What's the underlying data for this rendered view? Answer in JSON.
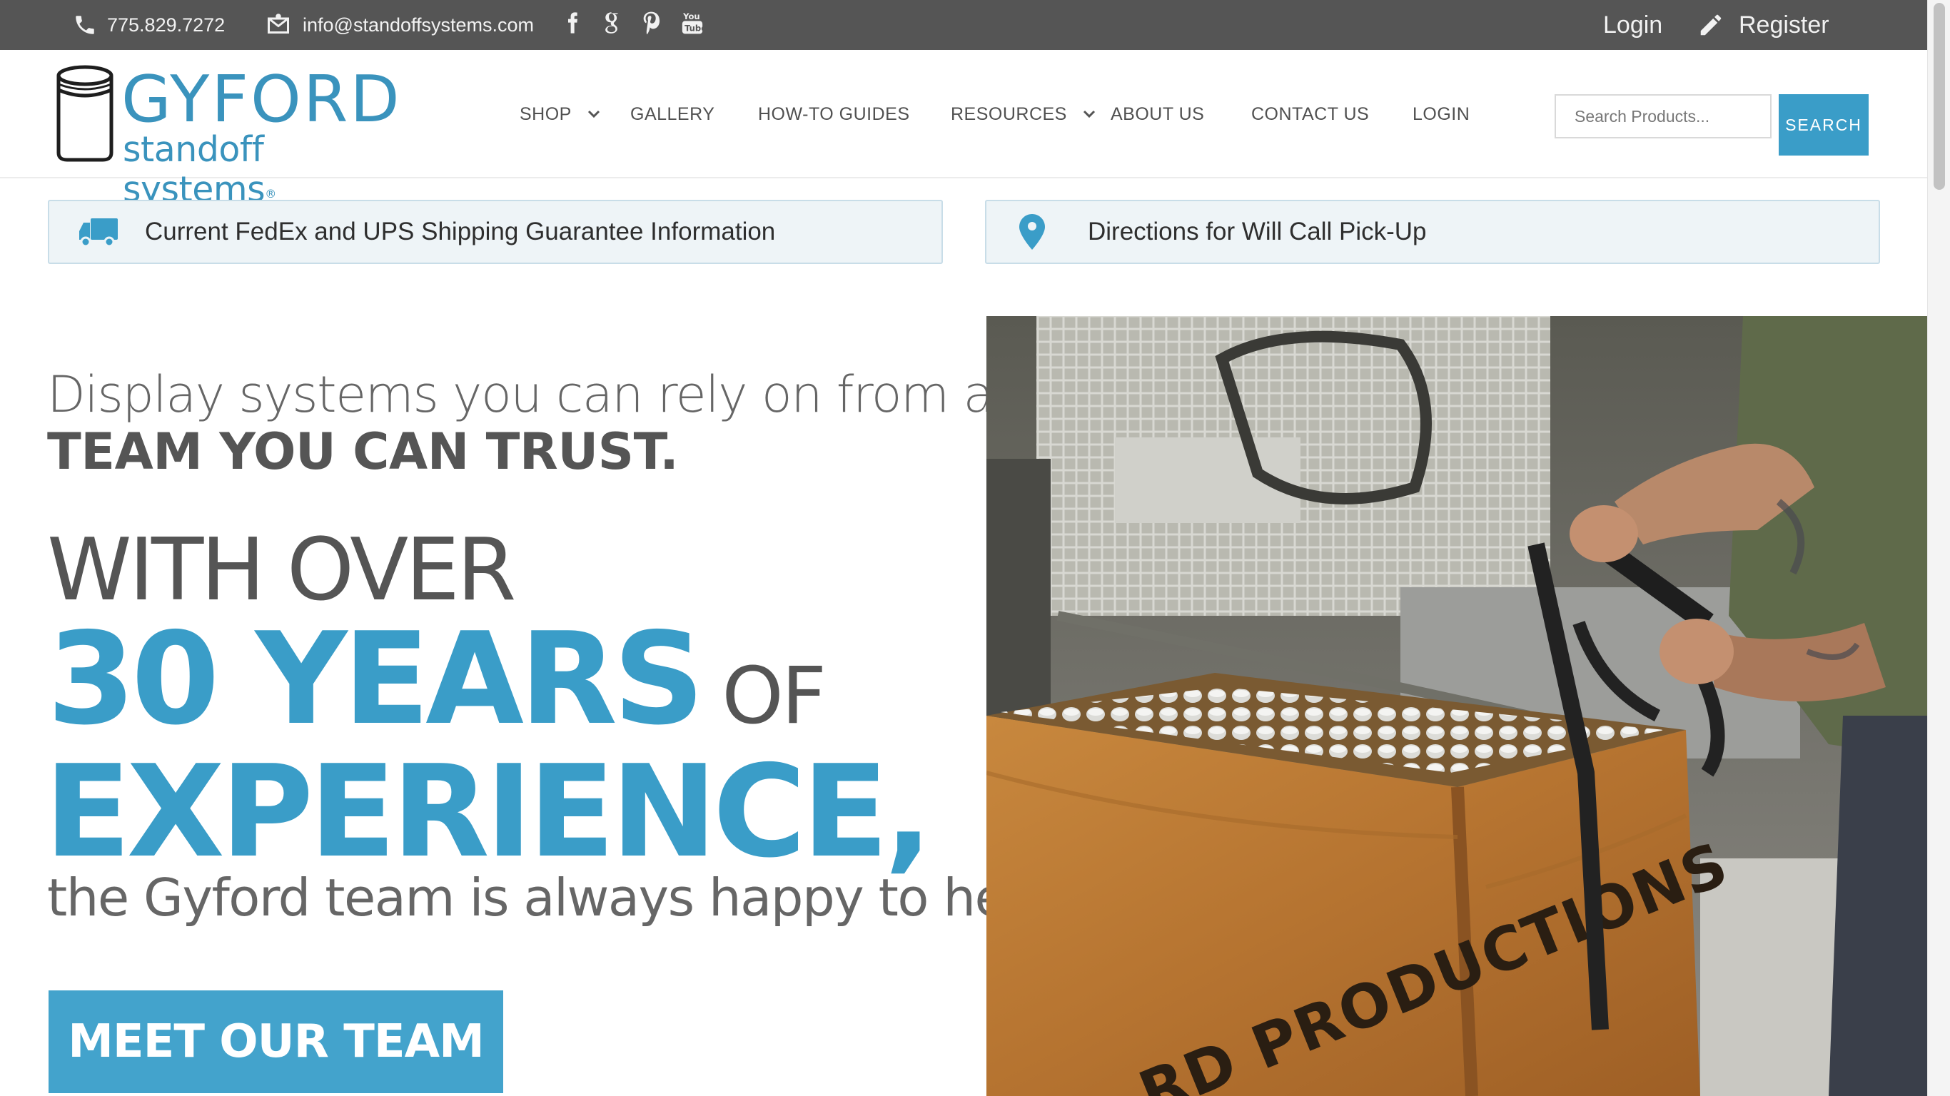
{
  "topbar": {
    "phone": "775.829.7272",
    "email": "info@standoffsystems.com",
    "social": [
      "facebook-icon",
      "google-plus-icon",
      "pinterest-icon",
      "youtube-icon"
    ],
    "login": "Login",
    "register": "Register"
  },
  "logo": {
    "name": "GYFORD",
    "subtitle": "standoff systems",
    "trademark": "®"
  },
  "nav": {
    "items": [
      "SHOP",
      "GALLERY",
      "HOW-TO GUIDES",
      "RESOURCES",
      "ABOUT US",
      "CONTACT US",
      "LOGIN"
    ]
  },
  "search": {
    "placeholder": "Search Products...",
    "button": "SEARCH"
  },
  "info": {
    "shipping": "Current FedEx and UPS Shipping Guarantee Information",
    "directions": "Directions for Will Call Pick-Up"
  },
  "hero": {
    "line1": "Display systems you can rely on from a",
    "line2": "TEAM YOU CAN TRUST.",
    "line3": "WITH OVER",
    "big1": "30 YEARS",
    "of": "OF",
    "big2": "EXPERIENCE,",
    "line6": "the Gyford team is always happy to help!",
    "cta": "MEET OUR TEAM"
  },
  "photo": {
    "crate_text": "RD PRODUCTIONS"
  },
  "colors": {
    "brand_blue": "#3a9dc8",
    "topbar_bg": "#555555",
    "info_bg": "#eef4f7"
  }
}
